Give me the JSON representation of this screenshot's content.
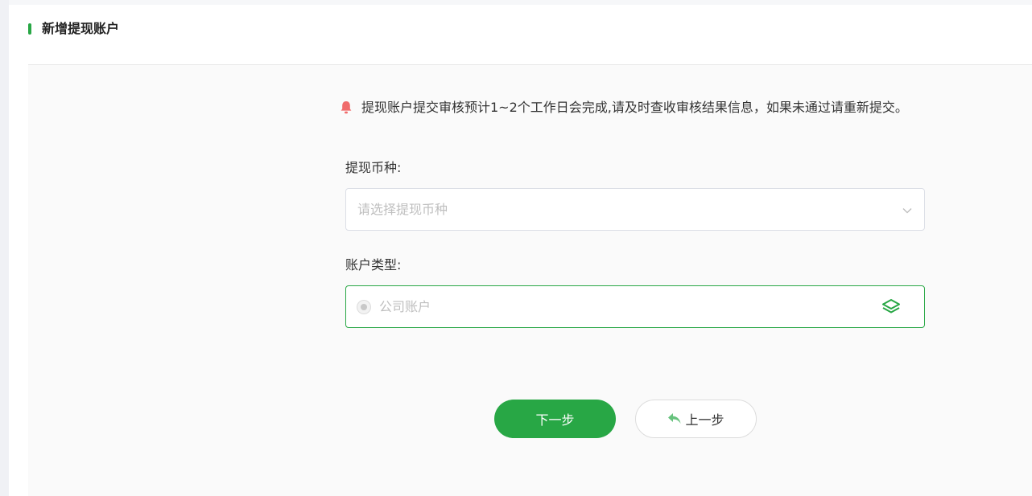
{
  "header": {
    "title": "新增提现账户"
  },
  "notice": {
    "icon": "bell-icon",
    "text": "提现账户提交审核预计1~2个工作日会完成,请及时查收审核结果信息，如果未通过请重新提交。",
    "icon_color": "#f06b6b"
  },
  "form": {
    "currency": {
      "label": "提现币种:",
      "placeholder": "请选择提现币种",
      "icon": "chevron-down-icon"
    },
    "account_type": {
      "label": "账户类型:",
      "option": "公司账户",
      "icon": "layers-icon"
    }
  },
  "buttons": {
    "next": "下一步",
    "prev": "上一步",
    "prev_icon": "reply-icon"
  },
  "colors": {
    "accent": "#28a745",
    "placeholder": "#bfbfbf",
    "prev_icon": "#67c27d"
  }
}
